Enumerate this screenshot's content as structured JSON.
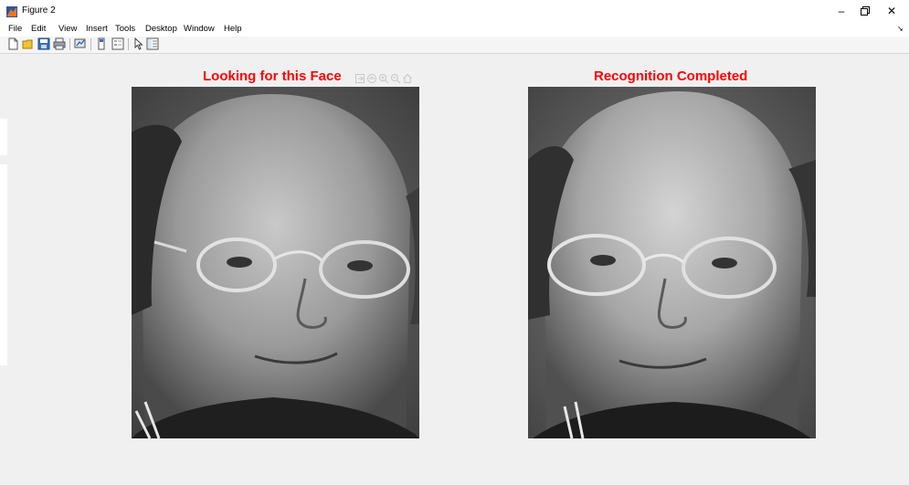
{
  "window": {
    "title": "Figure 2",
    "minimize": "–",
    "restore": "🗗",
    "close": "✕"
  },
  "menu": [
    "File",
    "Edit",
    "View",
    "Insert",
    "Tools",
    "Desktop",
    "Window",
    "Help"
  ],
  "toolbar_icons": [
    "new-figure-icon",
    "open-file-icon",
    "save-icon",
    "print-icon",
    "link-plot-icon",
    "insert-colorbar-icon",
    "insert-legend-icon",
    "edit-plot-icon",
    "property-inspector-icon"
  ],
  "axes_toolbar_icons": [
    "export-icon",
    "pan-icon",
    "zoom-in-icon",
    "zoom-out-icon",
    "home-icon"
  ],
  "left_panel": {
    "title": "Looking for this Face"
  },
  "right_panel": {
    "title": "Recognition Completed"
  },
  "colors": {
    "title_red": "#ff0000",
    "background": "#f0f0f0"
  }
}
